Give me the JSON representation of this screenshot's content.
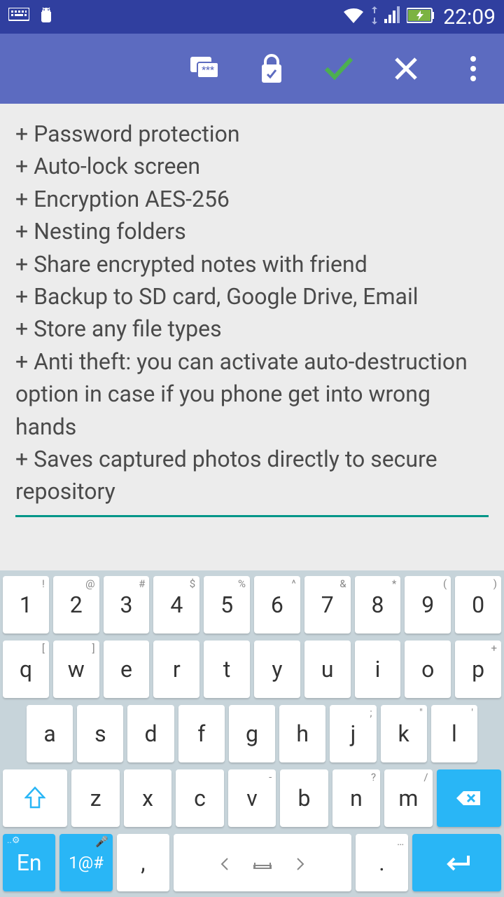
{
  "status": {
    "time": "22:09"
  },
  "note": {
    "text": "+ Password protection\n+ Auto-lock screen\n+ Encryption AES-256\n+ Nesting folders\n+ Share encrypted notes with friend\n+ Backup to SD card, Google Drive, Email\n+ Store any file types\n+ Anti theft: you can activate auto-destruction option in case if you phone get into wrong hands\n+ Saves captured photos directly to secure repository"
  },
  "keyboard": {
    "row1": [
      {
        "main": "1",
        "sub": "!"
      },
      {
        "main": "2",
        "sub": "@"
      },
      {
        "main": "3",
        "sub": "#"
      },
      {
        "main": "4",
        "sub": "$"
      },
      {
        "main": "5",
        "sub": "%"
      },
      {
        "main": "6",
        "sub": "^"
      },
      {
        "main": "7",
        "sub": "&"
      },
      {
        "main": "8",
        "sub": "*"
      },
      {
        "main": "9",
        "sub": "("
      },
      {
        "main": "0",
        "sub": ")"
      }
    ],
    "row2": [
      {
        "main": "q",
        "sub": "["
      },
      {
        "main": "w",
        "sub": "]"
      },
      {
        "main": "e",
        "sub": ""
      },
      {
        "main": "r",
        "sub": ""
      },
      {
        "main": "t",
        "sub": ""
      },
      {
        "main": "y",
        "sub": ""
      },
      {
        "main": "u",
        "sub": ""
      },
      {
        "main": "i",
        "sub": ""
      },
      {
        "main": "o",
        "sub": ""
      },
      {
        "main": "p",
        "sub": "+"
      }
    ],
    "row3": [
      {
        "main": "a",
        "sub": ""
      },
      {
        "main": "s",
        "sub": ""
      },
      {
        "main": "d",
        "sub": ""
      },
      {
        "main": "f",
        "sub": ""
      },
      {
        "main": "g",
        "sub": ""
      },
      {
        "main": "h",
        "sub": ""
      },
      {
        "main": "j",
        "sub": ";"
      },
      {
        "main": "k",
        "sub": "\""
      },
      {
        "main": "l",
        "sub": "'"
      }
    ],
    "row4": [
      {
        "main": "z",
        "sub": ""
      },
      {
        "main": "x",
        "sub": ""
      },
      {
        "main": "c",
        "sub": ""
      },
      {
        "main": "v",
        "sub": "-"
      },
      {
        "main": "b",
        "sub": ""
      },
      {
        "main": "n",
        "sub": "?"
      },
      {
        "main": "m",
        "sub": "/"
      }
    ],
    "row5": {
      "lang": "En",
      "sym": "1@#",
      "comma": ",",
      "period": "."
    }
  }
}
